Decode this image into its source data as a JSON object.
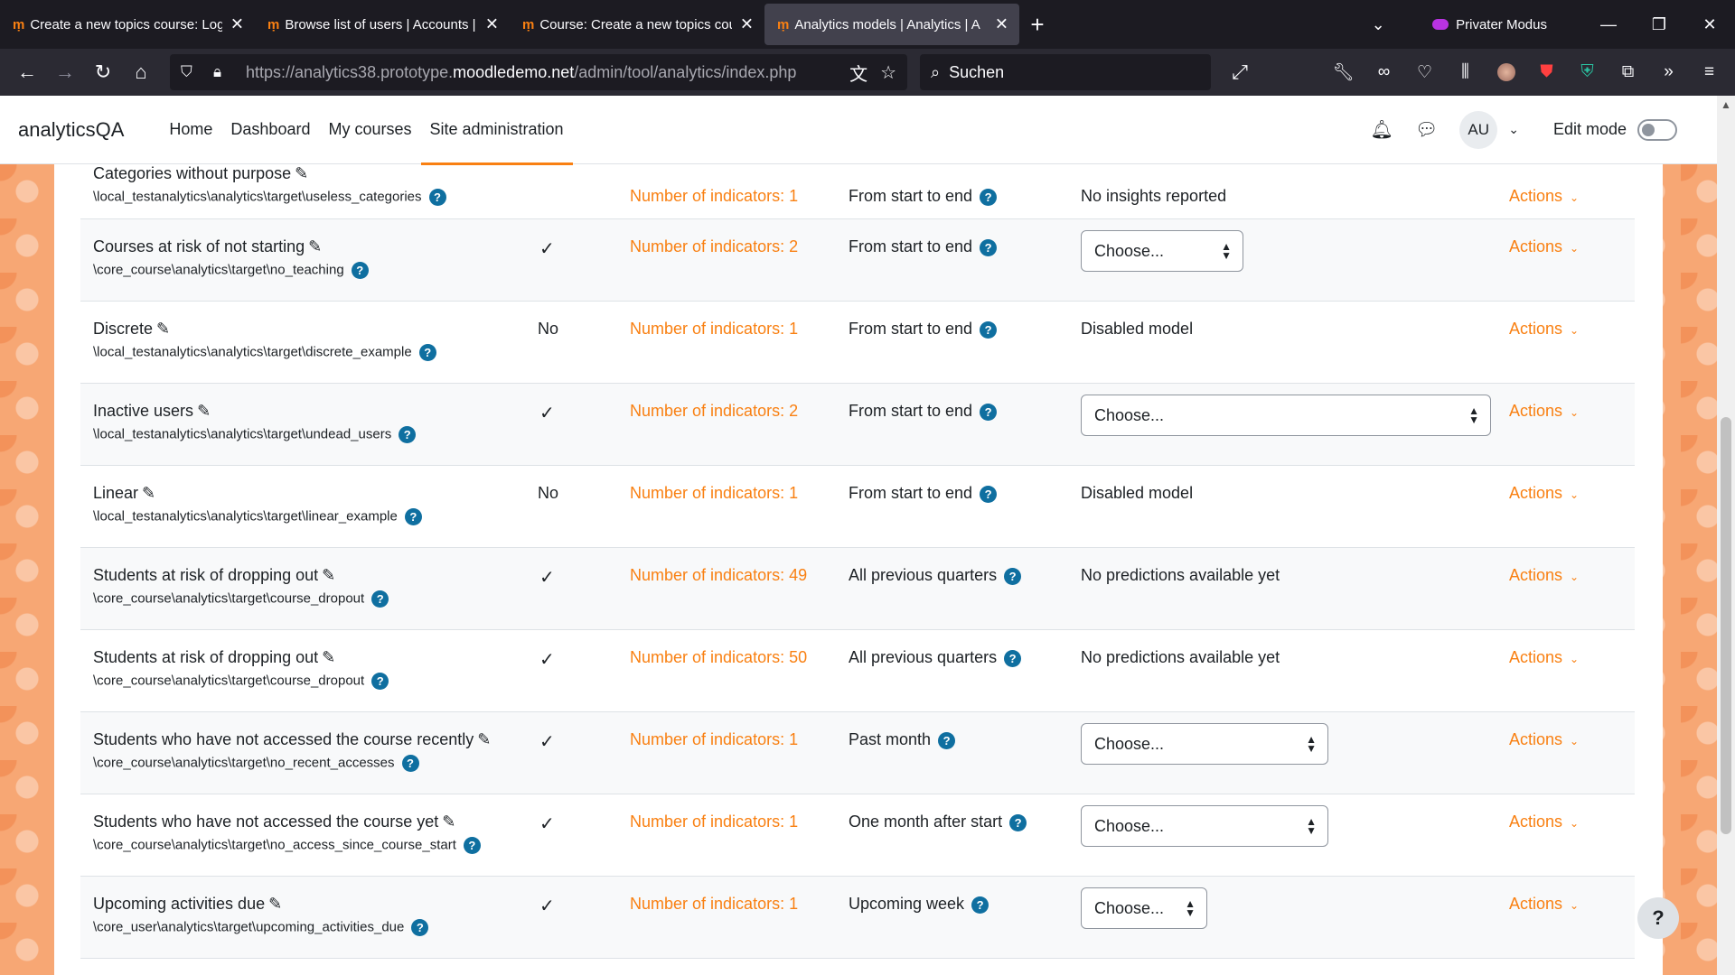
{
  "browser": {
    "tabs": [
      {
        "title": "Create a new topics course: Log",
        "active": false
      },
      {
        "title": "Browse list of users | Accounts |",
        "active": false
      },
      {
        "title": "Course: Create a new topics cou",
        "active": false
      },
      {
        "title": "Analytics models | Analytics | A",
        "active": true
      }
    ],
    "new_tab": "+",
    "private_label": "Privater Modus",
    "url_host_dim": "https://analytics38.prototype.",
    "url_host": "moodledemo.net",
    "url_path": "/admin/tool/analytics/index.php",
    "search_placeholder": "Suchen"
  },
  "moodle": {
    "brand": "analyticsQA",
    "nav": [
      {
        "label": "Home",
        "active": false
      },
      {
        "label": "Dashboard",
        "active": false
      },
      {
        "label": "My courses",
        "active": false
      },
      {
        "label": "Site administration",
        "active": true
      }
    ],
    "user_initials": "AU",
    "edit_mode_label": "Edit mode"
  },
  "models": [
    {
      "name": "Categories without purpose",
      "target": "\\local_testanalytics\\analytics\\target\\useless_categories",
      "enabled": "",
      "indicators": "Number of indicators: 1",
      "time_splitting": "From start to end",
      "insights": "No insights reported",
      "insights_type": "text",
      "actions": "Actions",
      "partial": true
    },
    {
      "name": "Courses at risk of not starting",
      "target": "\\core_course\\analytics\\target\\no_teaching",
      "enabled": "✓",
      "indicators": "Number of indicators: 2",
      "time_splitting": "From start to end",
      "insights": "Choose...",
      "insights_type": "select",
      "select_width": 180,
      "actions": "Actions"
    },
    {
      "name": "Discrete",
      "target": "\\local_testanalytics\\analytics\\target\\discrete_example",
      "enabled": "No",
      "indicators": "Number of indicators: 1",
      "time_splitting": "From start to end",
      "insights": "Disabled model",
      "insights_type": "text",
      "actions": "Actions"
    },
    {
      "name": "Inactive users",
      "target": "\\local_testanalytics\\analytics\\target\\undead_users",
      "enabled": "✓",
      "indicators": "Number of indicators: 2",
      "time_splitting": "From start to end",
      "insights": "Choose...",
      "insights_type": "select",
      "select_width": 454,
      "actions": "Actions"
    },
    {
      "name": "Linear",
      "target": "\\local_testanalytics\\analytics\\target\\linear_example",
      "enabled": "No",
      "indicators": "Number of indicators: 1",
      "time_splitting": "From start to end",
      "insights": "Disabled model",
      "insights_type": "text",
      "actions": "Actions"
    },
    {
      "name": "Students at risk of dropping out",
      "target": "\\core_course\\analytics\\target\\course_dropout",
      "enabled": "✓",
      "indicators": "Number of indicators: 49",
      "time_splitting": "All previous quarters",
      "insights": "No predictions available yet",
      "insights_type": "text",
      "actions": "Actions"
    },
    {
      "name": "Students at risk of dropping out",
      "target": "\\core_course\\analytics\\target\\course_dropout",
      "enabled": "✓",
      "indicators": "Number of indicators: 50",
      "time_splitting": "All previous quarters",
      "insights": "No predictions available yet",
      "insights_type": "text",
      "actions": "Actions"
    },
    {
      "name": "Students who have not accessed the course recently",
      "target": "\\core_course\\analytics\\target\\no_recent_accesses",
      "enabled": "✓",
      "indicators": "Number of indicators: 1",
      "time_splitting": "Past month",
      "insights": "Choose...",
      "insights_type": "select",
      "select_width": 274,
      "actions": "Actions"
    },
    {
      "name": "Students who have not accessed the course yet",
      "target": "\\core_course\\analytics\\target\\no_access_since_course_start",
      "enabled": "✓",
      "indicators": "Number of indicators: 1",
      "time_splitting": "One month after start",
      "insights": "Choose...",
      "insights_type": "select",
      "select_width": 274,
      "actions": "Actions"
    },
    {
      "name": "Upcoming activities due",
      "target": "\\core_user\\analytics\\target\\upcoming_activities_due",
      "enabled": "✓",
      "indicators": "Number of indicators: 1",
      "time_splitting": "Upcoming week",
      "insights": "Choose...",
      "insights_type": "select",
      "select_width": 140,
      "actions": "Actions"
    }
  ],
  "help_fab": "?"
}
